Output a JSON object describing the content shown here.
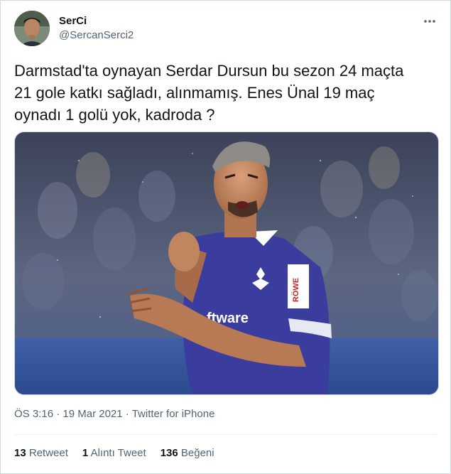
{
  "user": {
    "display_name": "SerCi",
    "handle": "@SercanSerci2"
  },
  "icons": {
    "more": "more-dots-icon"
  },
  "tweet": {
    "line1": "Darmstad'ta oynayan Serdar Dursun bu sezon 24 maçta",
    "line2": "21 gole katkı sağladı, alınmamış. Enes Ünal 19 maç",
    "line3": "oynadı 1 golü yok, kadroda ?"
  },
  "photo": {
    "sponsor_text": "ftware",
    "badge_text": "RÖWE"
  },
  "meta": {
    "time": "ÖS 3:16",
    "date": "19 Mar 2021",
    "source": "Twitter for iPhone",
    "separator": "·"
  },
  "stats": {
    "retweets_count": "13",
    "retweets_label": "Retweet",
    "quotes_count": "1",
    "quotes_label": "Alıntı Tweet",
    "likes_count": "136",
    "likes_label": "Beğeni"
  },
  "colors": {
    "text": "#0f1419",
    "secondary": "#536471",
    "border": "#cfd9de",
    "jersey": "#3a3d9e"
  }
}
